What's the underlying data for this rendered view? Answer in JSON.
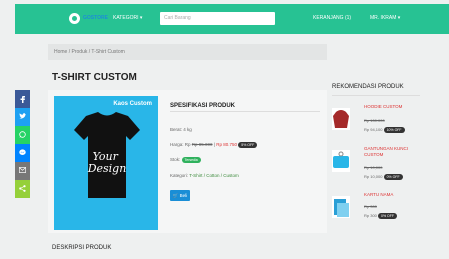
{
  "header": {
    "logo_text": "GOSTORE",
    "nav_kategori": "KATEGORI ▾",
    "search_placeholder": "Cari Barang",
    "cart": "KERANJANG (1)",
    "user": "MR. IKRAM ▾"
  },
  "breadcrumb": "Home / Produk / T-Shirt Custom",
  "page_title": "T-SHIRT CUSTOM",
  "product_image": {
    "title": "Kaos Custom",
    "shirt_text": "Your Design"
  },
  "spec": {
    "title": "SPESIFIKASI PRODUK",
    "berat": "Berat: 4 kg",
    "harga_label": "Harga: Rp ",
    "harga_strike": "Rp 85.000",
    "harga_sep": " | ",
    "harga_final": "Rp 80.750",
    "harga_badge": "5% OFF",
    "stok_label": "Stok: ",
    "stok_badge": "Tersedia",
    "kategori_label": "Kategori: ",
    "kategori_value": "T-Shirt / Cotton / Custom",
    "beli_label": "🛒 Beli"
  },
  "recommendation": {
    "title": "REKOMENDASI PRODUK",
    "items": [
      {
        "name": "HOODIE CUSTOM",
        "strike": "Rp 100.000",
        "price": "Rp 94,100",
        "badge": "10% OFF",
        "color": "#a52a2a"
      },
      {
        "name": "GANTUNGAN KUNCI CUSTOM",
        "strike": "Rp 10,000",
        "price": "Rp 10,000",
        "badge": "0% OFF",
        "color": "#29b6e8"
      },
      {
        "name": "KARTU NAMA",
        "strike": "Rp 300",
        "price": "Rp 300",
        "badge": "0% OFF",
        "color": "#2a9fd6"
      }
    ]
  },
  "deskripsi_title": "DESKRIPSI PRODUK",
  "share": [
    {
      "icon": "facebook-icon",
      "color": "#3b5998"
    },
    {
      "icon": "twitter-icon",
      "color": "#1da1f2"
    },
    {
      "icon": "whatsapp-icon",
      "color": "#25d366"
    },
    {
      "icon": "messenger-icon",
      "color": "#0084ff"
    },
    {
      "icon": "email-icon",
      "color": "#777777"
    },
    {
      "icon": "share-icon",
      "color": "#95d03a"
    }
  ]
}
